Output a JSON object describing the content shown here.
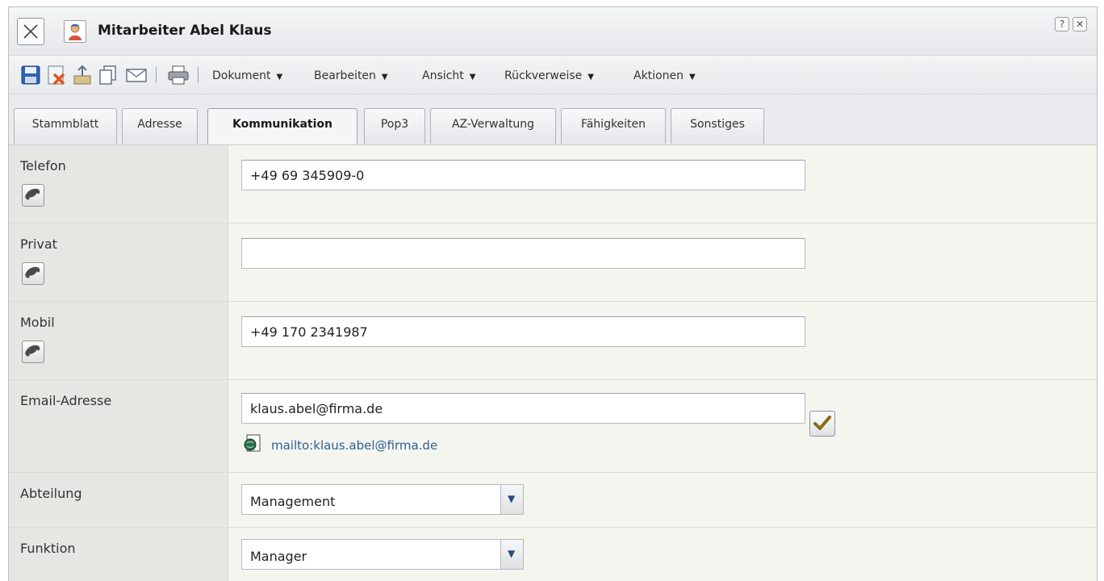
{
  "window": {
    "title": "Mitarbeiter Abel Klaus",
    "help_label": "?",
    "close_label": "✕"
  },
  "toolbar": {
    "icons": [
      "save-icon",
      "delete-icon",
      "export-icon",
      "copy-icon",
      "mail-icon",
      "print-icon"
    ],
    "menus": [
      {
        "label": "Dokument",
        "arrow": "▼"
      },
      {
        "label": "Bearbeiten",
        "arrow": "▼"
      },
      {
        "label": "Ansicht",
        "arrow": "▼"
      },
      {
        "label": "Rückverweise",
        "arrow": "▼"
      },
      {
        "label": "Aktionen",
        "arrow": "▼"
      }
    ]
  },
  "tabs": [
    {
      "label": "Stammblatt",
      "active": false
    },
    {
      "label": "Adresse",
      "active": false
    },
    {
      "label": "Kommunikation",
      "active": true
    },
    {
      "label": "Pop3",
      "active": false
    },
    {
      "label": "AZ-Verwaltung",
      "active": false
    },
    {
      "label": "Fähigkeiten",
      "active": false
    },
    {
      "label": "Sonstiges",
      "active": false
    }
  ],
  "form": {
    "telefon": {
      "label": "Telefon",
      "value": "+49 69 345909-0"
    },
    "privat": {
      "label": "Privat",
      "value": ""
    },
    "mobil": {
      "label": "Mobil",
      "value": "+49 170 2341987"
    },
    "email": {
      "label": "Email-Adresse",
      "value": "klaus.abel@firma.de",
      "mailto": "mailto:klaus.abel@firma.de"
    },
    "abteilung": {
      "label": "Abteilung",
      "value": "Management"
    },
    "funktion": {
      "label": "Funktion",
      "value": "Manager"
    }
  },
  "colors": {
    "link": "#2d5f9a",
    "label_bg": "#e6e6e3",
    "field_bg": "#f5f5ef",
    "check": "#8a6a1a"
  }
}
